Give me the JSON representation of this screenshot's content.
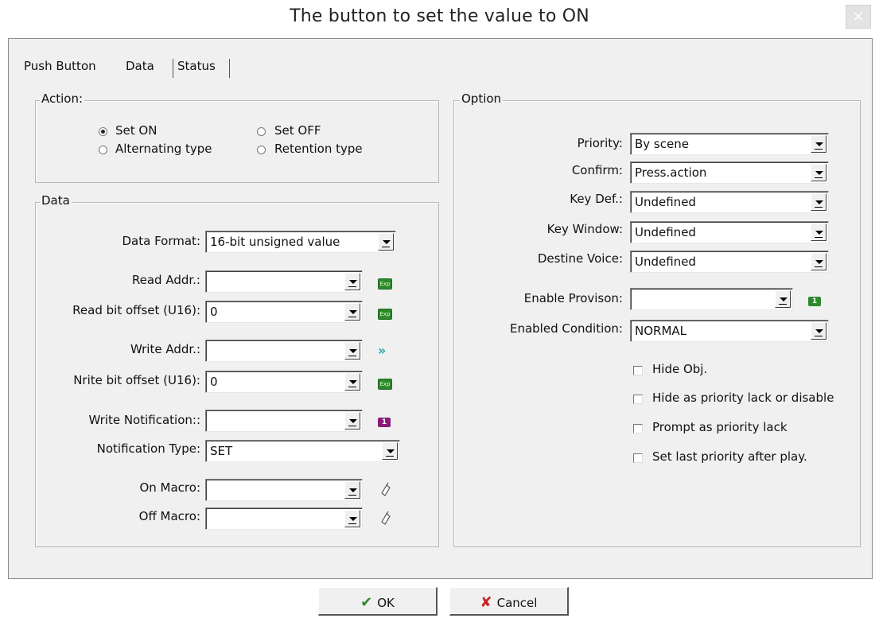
{
  "window": {
    "title": "The button to set the value to ON",
    "close_glyph": "×"
  },
  "tabs": [
    "Push Button",
    "Data",
    "Status"
  ],
  "action": {
    "legend": "Action:",
    "options": [
      "Set ON",
      "Set OFF",
      "Alternating type",
      "Retention type"
    ],
    "selected": "Set ON"
  },
  "data": {
    "legend": "Data",
    "fields": [
      {
        "label": "Data Format:",
        "value": "16-bit unsigned value"
      },
      {
        "label": "Read Addr.:",
        "value": "",
        "icon": "exp-icon"
      },
      {
        "label": "Read bit offset (U16):",
        "value": "0",
        "icon": "exp-icon"
      },
      {
        "label": "Write Addr.:",
        "value": "",
        "icon": "jump-icon"
      },
      {
        "label": "Nrite bit offset (U16):",
        "value": "0",
        "icon": "exp-icon"
      },
      {
        "label": "Write Notification::",
        "value": "",
        "icon": "notification-icon"
      },
      {
        "label": "Notification Type:",
        "value": "SET"
      },
      {
        "label": "On Macro:",
        "value": "",
        "icon": "macro-icon"
      },
      {
        "label": "Off Macro:",
        "value": "",
        "icon": "macro-icon"
      }
    ],
    "exp_icon_text": "Exp",
    "notification_icon_text": "1",
    "jump_icon_text": "»"
  },
  "option": {
    "legend": "Option",
    "fields": [
      {
        "label": "Priority:",
        "value": "By scene"
      },
      {
        "label": "Confirm:",
        "value": "Press.action"
      },
      {
        "label": "Key Def.:",
        "value": "Undefined"
      },
      {
        "label": "Key Window:",
        "value": "Undefined"
      },
      {
        "label": "Destine Voice:",
        "value": "Undefined"
      },
      {
        "label": "Enable Provison:",
        "value": "",
        "icon": "enable-icon"
      },
      {
        "label": "Enabled Condition:",
        "value": "NORMAL"
      }
    ],
    "enable_icon_text": "1",
    "checkboxes": [
      {
        "label": "Hide Obj.",
        "checked": false
      },
      {
        "label": "Hide as priority lack or disable",
        "checked": false
      },
      {
        "label": "Prompt as priority lack",
        "checked": false
      },
      {
        "label": "Set last priority after play.",
        "checked": false
      }
    ]
  },
  "buttons": {
    "ok": {
      "label": "OK",
      "icon": "checkmark-icon",
      "glyph": "✔"
    },
    "cancel": {
      "label": "Cancel",
      "icon": "x-mark-icon",
      "glyph": "✘"
    }
  },
  "colors": {
    "exp_icon": "#2c8a2c",
    "notification_icon": "#8a1a7a",
    "enable_icon": "#2c8a2c",
    "ok_glyph": "#2e8b2e",
    "cancel_glyph": "#cc2222"
  }
}
